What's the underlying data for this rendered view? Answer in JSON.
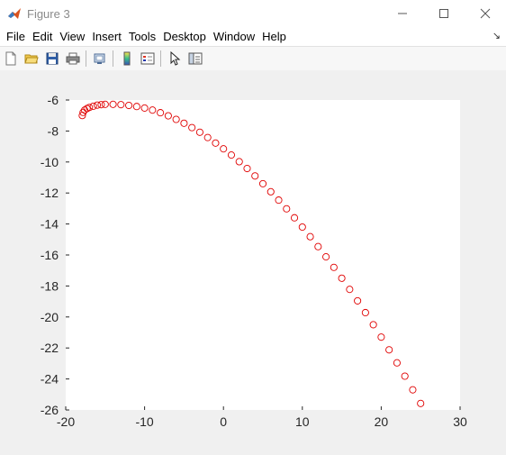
{
  "window": {
    "title": "Figure 3",
    "controls": [
      "minimize",
      "maximize",
      "close"
    ]
  },
  "menu": {
    "items": [
      "File",
      "Edit",
      "View",
      "Insert",
      "Tools",
      "Desktop",
      "Window",
      "Help"
    ],
    "dock_arrow": "↘"
  },
  "toolbar": {
    "buttons": [
      "new-figure-icon",
      "open-file-icon",
      "save-icon",
      "print-icon",
      "link-plot-icon",
      "colorbar-icon",
      "legend-icon",
      "edit-plot-arrow-icon",
      "property-inspector-icon"
    ]
  },
  "colors": {
    "marker": "#e00000",
    "axes_background": "#ffffff",
    "figure_background": "#f0f0f0"
  },
  "chart_data": {
    "type": "scatter",
    "marker": "circle-open",
    "xlim": [
      -20,
      30
    ],
    "ylim": [
      -26,
      -6
    ],
    "xticks": [
      -20,
      -10,
      0,
      10,
      20,
      30
    ],
    "yticks": [
      -6,
      -8,
      -10,
      -12,
      -14,
      -16,
      -18,
      -20,
      -22,
      -24,
      -26
    ],
    "grid": false,
    "series": [
      {
        "points": [
          [
            -17.9,
            -7.0
          ],
          [
            -17.8,
            -6.8
          ],
          [
            -17.6,
            -6.65
          ],
          [
            -17.3,
            -6.55
          ],
          [
            -17.0,
            -6.48
          ],
          [
            -16.5,
            -6.4
          ],
          [
            -16.0,
            -6.33
          ],
          [
            -15.5,
            -6.3
          ],
          [
            -15.0,
            -6.28
          ],
          [
            -14.0,
            -6.28
          ],
          [
            -13.0,
            -6.3
          ],
          [
            -12.0,
            -6.35
          ],
          [
            -11.0,
            -6.42
          ],
          [
            -10.0,
            -6.52
          ],
          [
            -9.0,
            -6.65
          ],
          [
            -8.0,
            -6.82
          ],
          [
            -7.0,
            -7.02
          ],
          [
            -6.0,
            -7.25
          ],
          [
            -5.0,
            -7.5
          ],
          [
            -4.0,
            -7.78
          ],
          [
            -3.0,
            -8.08
          ],
          [
            -2.0,
            -8.42
          ],
          [
            -1.0,
            -8.78
          ],
          [
            0.0,
            -9.15
          ],
          [
            1.0,
            -9.55
          ],
          [
            2.0,
            -9.98
          ],
          [
            3.0,
            -10.42
          ],
          [
            4.0,
            -10.9
          ],
          [
            5.0,
            -11.4
          ],
          [
            6.0,
            -11.92
          ],
          [
            7.0,
            -12.46
          ],
          [
            8.0,
            -13.02
          ],
          [
            9.0,
            -13.6
          ],
          [
            10.0,
            -14.2
          ],
          [
            11.0,
            -14.82
          ],
          [
            12.0,
            -15.46
          ],
          [
            13.0,
            -16.12
          ],
          [
            14.0,
            -16.8
          ],
          [
            15.0,
            -17.5
          ],
          [
            16.0,
            -18.22
          ],
          [
            17.0,
            -18.96
          ],
          [
            18.0,
            -19.72
          ],
          [
            19.0,
            -20.5
          ],
          [
            20.0,
            -21.3
          ],
          [
            21.0,
            -22.12
          ],
          [
            22.0,
            -22.96
          ],
          [
            23.0,
            -23.82
          ],
          [
            24.0,
            -24.7
          ],
          [
            25.0,
            -25.58
          ]
        ]
      }
    ]
  }
}
